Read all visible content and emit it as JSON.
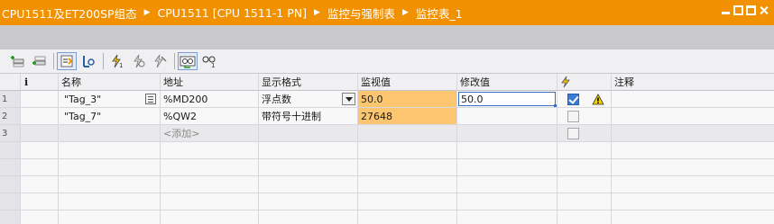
{
  "breadcrumb": [
    "CPU1511及ET200SP组态",
    "CPU1511 [CPU 1511-1 PN]",
    "监控与强制表",
    "监控表_1"
  ],
  "columns": {
    "name": "名称",
    "address": "地址",
    "display_format": "显示格式",
    "monitor_value": "监视值",
    "modify_value": "修改值",
    "comment": "注释"
  },
  "rows": [
    {
      "num": "1",
      "name": "\"Tag_3\"",
      "address": "%MD200",
      "display_format": "浮点数",
      "monitor_value": "50.0",
      "modify_value": "50.0",
      "checked": true,
      "warning": true
    },
    {
      "num": "2",
      "name": "\"Tag_7\"",
      "address": "%QW2",
      "display_format": "带符号十进制",
      "monitor_value": "27648",
      "modify_value": "",
      "checked": false,
      "warning": false
    },
    {
      "num": "3",
      "name": "",
      "address": "<添加>",
      "display_format": "",
      "monitor_value": "",
      "modify_value": "",
      "checked": false,
      "warning": false
    }
  ],
  "colors": {
    "accent": "#f29100",
    "monitor_highlight": "#fbc66f",
    "selection": "#3a6cc4"
  }
}
